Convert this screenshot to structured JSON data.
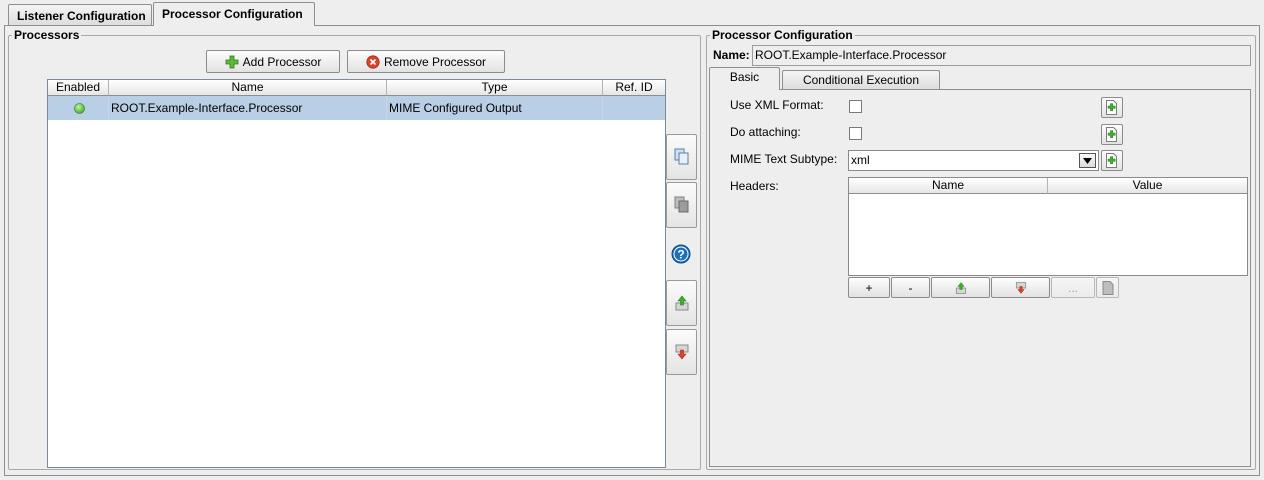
{
  "tabs": [
    {
      "label": "Listener Configuration",
      "active": false
    },
    {
      "label": "Processor Configuration",
      "active": true
    }
  ],
  "processors": {
    "title": "Processors",
    "add_label": "Add Processor",
    "remove_label": "Remove Processor",
    "columns": [
      "Enabled",
      "Name",
      "Type",
      "Ref. ID"
    ],
    "rows": [
      {
        "enabled": true,
        "name": "ROOT.Example-Interface.Processor",
        "type": "MIME Configured Output",
        "ref_id": ""
      }
    ],
    "side_buttons": [
      "copy-icon",
      "paste-icon",
      "help-icon",
      "move-up-icon",
      "move-down-icon"
    ]
  },
  "config": {
    "title": "Processor Configuration",
    "name_label": "Name:",
    "name_value": "ROOT.Example-Interface.Processor",
    "tabs": [
      {
        "label": "Basic",
        "active": true
      },
      {
        "label": "Conditional Execution",
        "active": false
      }
    ],
    "use_xml_label": "Use XML Format:",
    "use_xml_checked": false,
    "do_attaching_label": "Do attaching:",
    "do_attaching_checked": false,
    "mime_subtype_label": "MIME Text Subtype:",
    "mime_subtype_value": "xml",
    "headers_label": "Headers:",
    "headers_columns": [
      "Name",
      "Value"
    ],
    "header_buttons": {
      "add": "+",
      "remove": "-",
      "more": "..."
    }
  },
  "colors": {
    "selection": "#b8cfe5",
    "enabled_green": "#3fae2a",
    "remove_red": "#d9422b",
    "help_blue": "#1d6fb8"
  }
}
